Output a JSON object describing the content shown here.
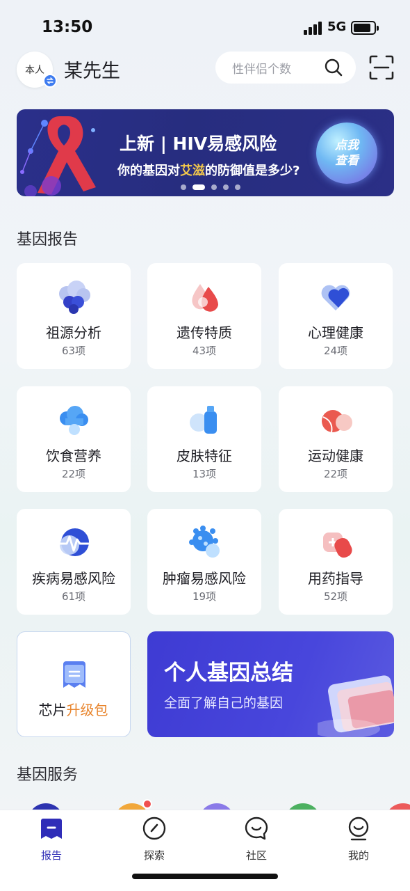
{
  "status_bar": {
    "time": "13:50",
    "network": "5G"
  },
  "header": {
    "avatar_label": "本人",
    "username": "某先生",
    "search_placeholder": "性伴侣个数"
  },
  "banner": {
    "title": "上新 | HIV易感风险",
    "subtitle_prefix": "你的基因对",
    "subtitle_highlight": "艾滋",
    "subtitle_suffix": "的防御值是多少?",
    "cta_line1": "点我",
    "cta_line2": "查看",
    "page_count": 5,
    "active_page": 2,
    "highlight_color": "#f3c84b"
  },
  "reports": {
    "section_title": "基因报告",
    "items": [
      {
        "name": "祖源分析",
        "count": "63项",
        "icon": "ancestry-cloud-icon"
      },
      {
        "name": "遗传特质",
        "count": "43项",
        "icon": "trait-drops-icon"
      },
      {
        "name": "心理健康",
        "count": "24项",
        "icon": "heart-icon"
      },
      {
        "name": "饮食营养",
        "count": "22项",
        "icon": "nutrition-cloud-icon"
      },
      {
        "name": "皮肤特征",
        "count": "13项",
        "icon": "skincare-bottle-icon"
      },
      {
        "name": "运动健康",
        "count": "22项",
        "icon": "tennis-ball-icon"
      },
      {
        "name": "疾病易感风险",
        "count": "61项",
        "icon": "pulse-icon"
      },
      {
        "name": "肿瘤易感风险",
        "count": "19项",
        "icon": "virus-icon"
      },
      {
        "name": "用药指导",
        "count": "52项",
        "icon": "medicine-icon"
      }
    ],
    "chip_upgrade": {
      "prefix": "芯片",
      "highlight": "升级包",
      "highlight_color": "#e8842c"
    },
    "summary": {
      "title": "个人基因总结",
      "subtitle": "全面了解自己的基因"
    }
  },
  "services": {
    "section_title": "基因服务"
  },
  "tabbar": {
    "items": [
      {
        "label": "报告",
        "icon": "report-icon",
        "active": true
      },
      {
        "label": "探索",
        "icon": "compass-icon",
        "active": false
      },
      {
        "label": "社区",
        "icon": "chat-bubble-icon",
        "active": false
      },
      {
        "label": "我的",
        "icon": "profile-smile-icon",
        "active": false
      }
    ],
    "active_color": "#3533b8"
  }
}
